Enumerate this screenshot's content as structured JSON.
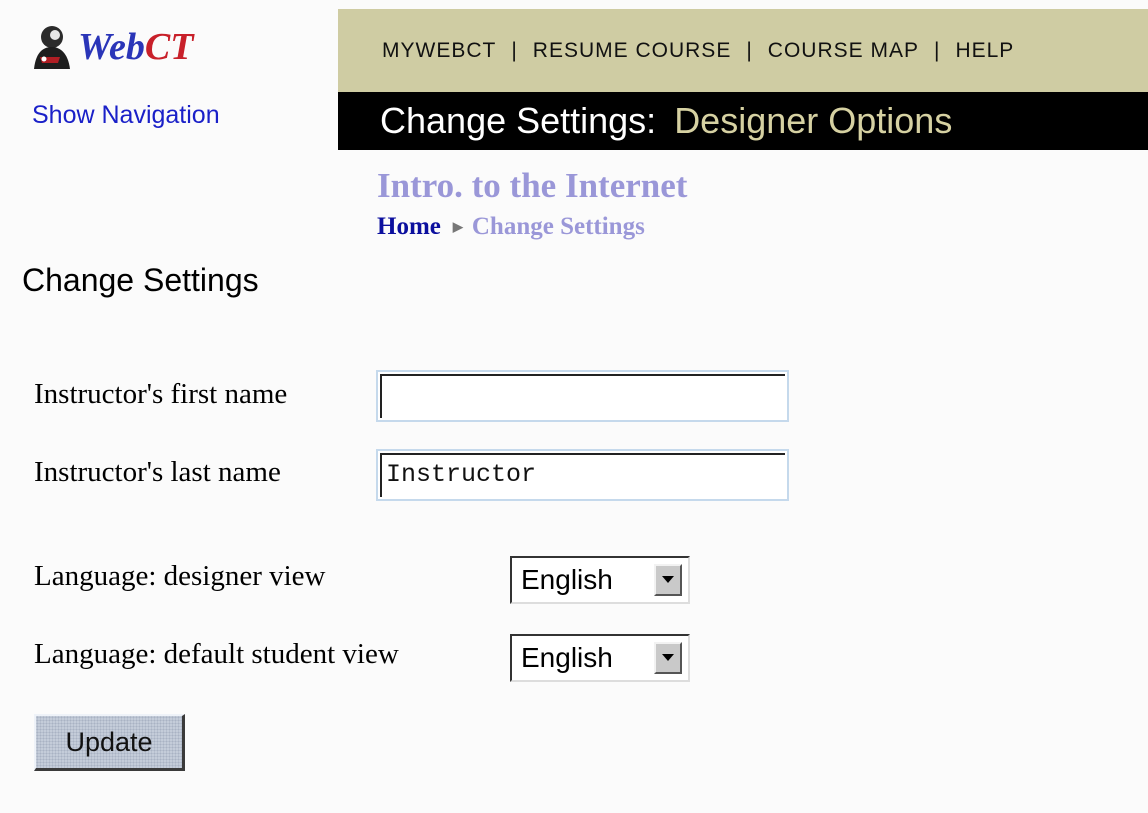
{
  "logo": {
    "text_part1": "Web",
    "text_part2": "CT"
  },
  "show_navigation": "Show Navigation",
  "topnav": {
    "items": [
      "MYWEBCT",
      "RESUME COURSE",
      "COURSE MAP",
      "HELP"
    ],
    "separator": "|"
  },
  "titlebar": {
    "prefix": "Change Settings:",
    "section": "Designer Options"
  },
  "course": {
    "title": "Intro. to the Internet"
  },
  "breadcrumb": {
    "home": "Home",
    "current": "Change Settings"
  },
  "page": {
    "heading": "Change Settings"
  },
  "form": {
    "first_name": {
      "label": "Instructor's first name",
      "value": ""
    },
    "last_name": {
      "label": "Instructor's last name",
      "value": "Instructor"
    },
    "designer_language": {
      "label": "Language: designer view",
      "selected": "English"
    },
    "student_language": {
      "label": "Language: default student view",
      "selected": "English"
    },
    "update_label": "Update"
  },
  "colors": {
    "topbar_bg": "#cfcca3",
    "titlebar_bg": "#000000",
    "section_title": "#d6d1a2",
    "course_title": "#9a97d8",
    "link_blue": "#0b0f9e"
  }
}
